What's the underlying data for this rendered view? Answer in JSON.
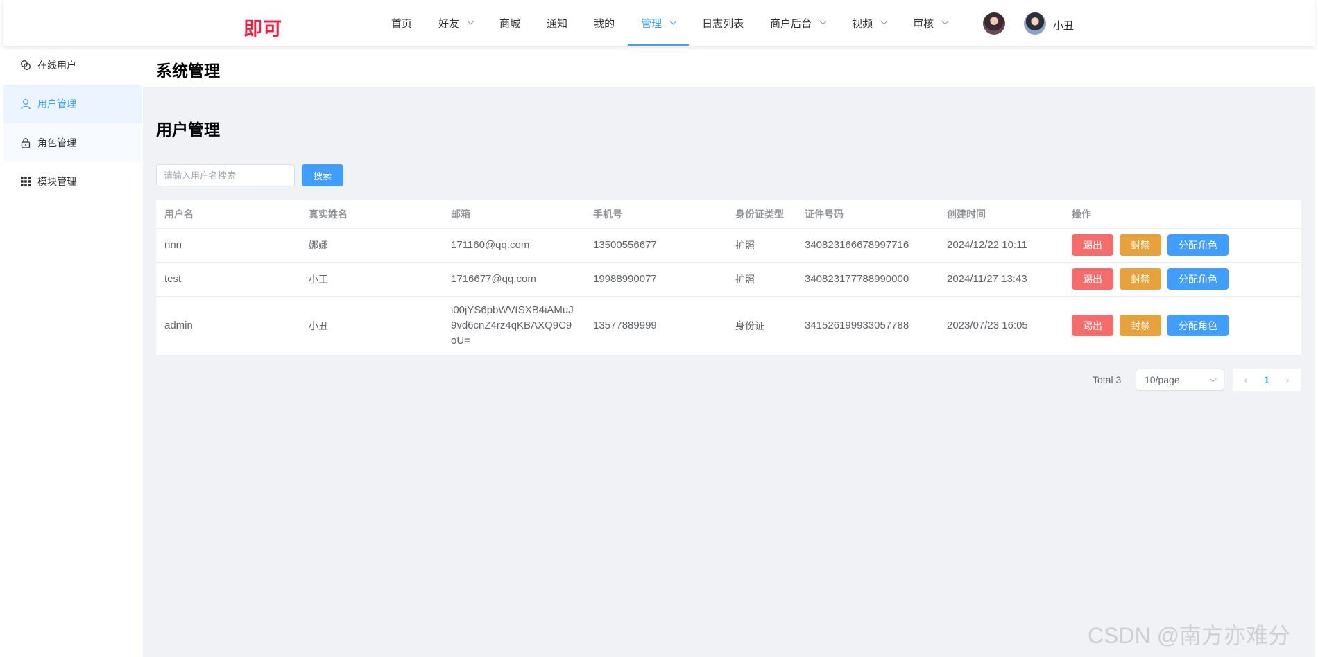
{
  "app": {
    "logo": "即可",
    "username": "小丑"
  },
  "nav": {
    "items": [
      {
        "label": "首页",
        "dropdown": false,
        "active": false
      },
      {
        "label": "好友",
        "dropdown": true,
        "active": false
      },
      {
        "label": "商城",
        "dropdown": false,
        "active": false
      },
      {
        "label": "通知",
        "dropdown": false,
        "active": false
      },
      {
        "label": "我的",
        "dropdown": false,
        "active": false
      },
      {
        "label": "管理",
        "dropdown": true,
        "active": true
      },
      {
        "label": "日志列表",
        "dropdown": false,
        "active": false
      },
      {
        "label": "商户后台",
        "dropdown": true,
        "active": false
      },
      {
        "label": "视频",
        "dropdown": true,
        "active": false
      },
      {
        "label": "审核",
        "dropdown": true,
        "active": false
      }
    ]
  },
  "sidebar": {
    "items": [
      {
        "label": "在线用户",
        "icon": "chat-icon",
        "active": false
      },
      {
        "label": "用户管理",
        "icon": "user-icon",
        "active": true
      },
      {
        "label": "角色管理",
        "icon": "lock-icon",
        "active": false
      },
      {
        "label": "模块管理",
        "icon": "grid-icon",
        "active": false
      }
    ]
  },
  "page": {
    "title": "系统管理",
    "section_title": "用户管理"
  },
  "search": {
    "placeholder": "请输入用户名搜索",
    "value": "",
    "button": "搜索"
  },
  "table": {
    "headers": [
      "用户名",
      "真实姓名",
      "邮箱",
      "手机号",
      "身份证类型",
      "证件号码",
      "创建时间",
      "操作"
    ],
    "rows": [
      {
        "username": "nnn",
        "realname": "娜娜",
        "email": "171160@qq.com",
        "phone": "13500556677",
        "id_type": "护照",
        "id_number": "340823166678997716",
        "created": "2024/12/22 10:11"
      },
      {
        "username": "test",
        "realname": "小王",
        "email": "1716677@qq.com",
        "phone": "19988990077",
        "id_type": "护照",
        "id_number": "340823177788990000",
        "created": "2024/11/27 13:43"
      },
      {
        "username": "admin",
        "realname": "小丑",
        "email": "i00jYS6pbWVtSXB4iAMuJ9vd6cnZ4rz4qKBAXQ9C9oU=",
        "phone": "13577889999",
        "id_type": "身份证",
        "id_number": "341526199933057788",
        "created": "2023/07/23 16:05"
      }
    ],
    "actions": {
      "kick": "踢出",
      "ban": "封禁",
      "assign_role": "分配角色"
    }
  },
  "pagination": {
    "total": "Total 3",
    "page_size": "10/page",
    "current_page": "1"
  },
  "watermark": "CSDN @南方亦难分",
  "colors": {
    "primary": "#409eff",
    "danger": "#f56c6c",
    "warning": "#e6a23c",
    "logo": "#ee2143",
    "background": "#f0f2f5"
  }
}
